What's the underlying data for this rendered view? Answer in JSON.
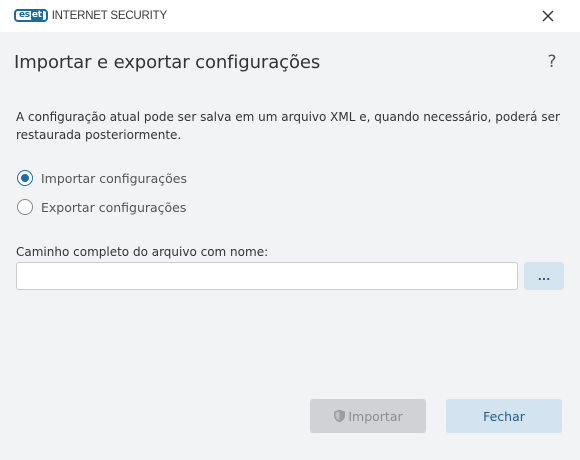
{
  "window": {
    "brand_logo_text": "eset",
    "product_name": "INTERNET SECURITY"
  },
  "header": {
    "title": "Importar e exportar configurações",
    "help_label": "?"
  },
  "description": "A configuração atual pode ser salva em um arquivo XML e, quando necessário, poderá ser restaurada posteriormente.",
  "options": [
    {
      "label": "Importar configurações",
      "selected": true
    },
    {
      "label": "Exportar configurações",
      "selected": false
    }
  ],
  "file_path": {
    "label": "Caminho completo do arquivo com nome:",
    "value": "",
    "placeholder": "",
    "browse_label": "..."
  },
  "footer": {
    "import_label": "Importar",
    "close_label": "Fechar"
  },
  "colors": {
    "accent": "#1e6fa6",
    "background": "#f2f3f5",
    "button_secondary": "#d3e3ef",
    "button_disabled": "#d0d2d5"
  },
  "icons": {
    "close": "close-icon",
    "shield": "shield-icon"
  }
}
